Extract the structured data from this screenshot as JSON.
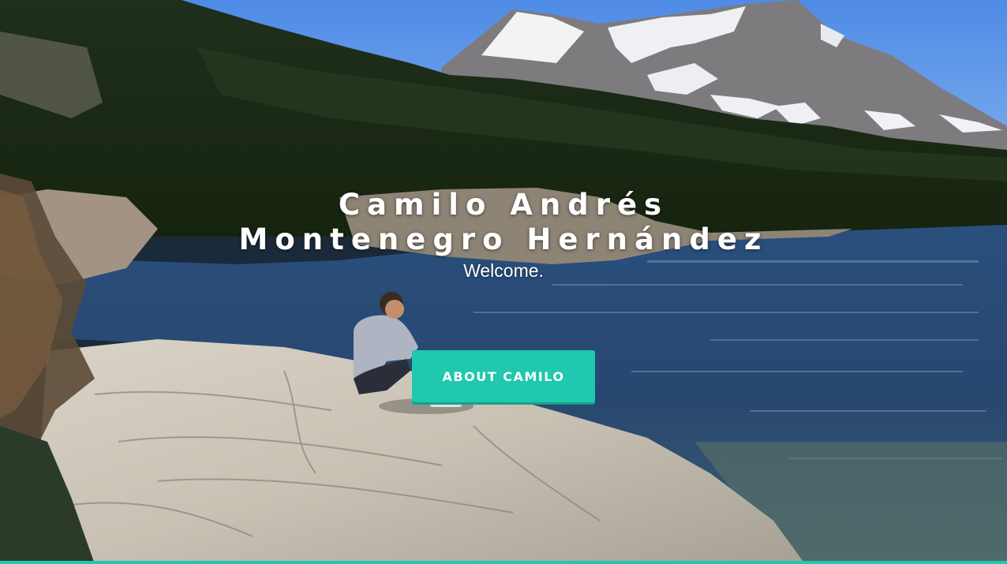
{
  "hero": {
    "title_line1": "Camilo Andrés",
    "title_line2": "Montenegro Hernández",
    "subtitle": "Welcome.",
    "background_description": "mountain-lake-landscape-photo",
    "cta": {
      "label": "ABOUT CAMILO"
    }
  },
  "colors": {
    "accent": "#1fc8ae",
    "accent_shadow": "#17a08b",
    "text": "#ffffff",
    "bottom_bar": "#25c6b0"
  }
}
